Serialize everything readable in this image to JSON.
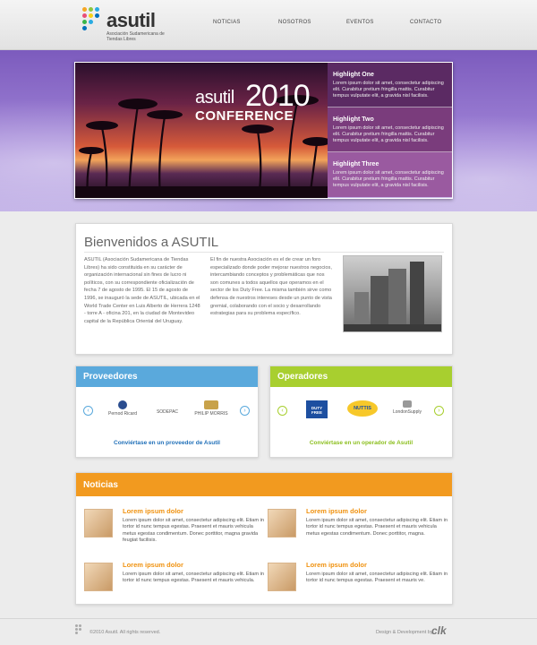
{
  "brand": {
    "name": "asutil",
    "subtitle": "Asociación Sudamericana de Tiendas Libres"
  },
  "nav": [
    "NOTICIAS",
    "NOSOTROS",
    "EVENTOS",
    "CONTACTO"
  ],
  "hero": {
    "brand": "asutil",
    "year": "2010",
    "word": "CONFERENCE",
    "highlights": [
      {
        "title": "Highlight One",
        "text": "Lorem ipsum dolor sit amet, consectetur adipiscing elit. Curabitur pretium fringilla mattis. Curabitur tempus vulputate elit, a gravida nisl facilisis."
      },
      {
        "title": "Highlight Two",
        "text": "Lorem ipsum dolor sit amet, consectetur adipiscing elit. Curabitur pretium fringilla mattis. Curabitur tempus vulputate elit, a gravida nisl facilisis."
      },
      {
        "title": "Highlight Three",
        "text": "Lorem ipsum dolor sit amet, consectetur adipiscing elit. Curabitur pretium fringilla mattis. Curabitur tempus vulputate elit, a gravida nisl facilisis."
      }
    ]
  },
  "welcome": {
    "title": "Bienvenidos a ASUTIL",
    "col1": "ASUTIL (Asociación Sudamericana de Tiendas Libres) ha sido constituida en su carácter de organización internacional sin fines de lucro ni políticos, con su correspondiente oficialización de fecha 7 de agosto de 1995. El 15 de agosto de 1996, se inauguró la sede de ASUTIL, ubicada en el World Trade Center en Luis Alberto de Herrera 1248 - torre A - oficina 201, en la ciudad de Montevideo capital de la República Oriental del Uruguay.",
    "col2": "El fin de nuestra Asociación es el de crear un foro especializado donde poder mejorar nuestros negocios, intercambiando conceptos y problemáticas que nos son comunes a todos aquellos que operamos en el sector de los Duty Free. La misma también sirve como defensa de nuestros intereses desde un punto de vista gremial, colaborando con el socio y desarrollando estrategias para su problema específico."
  },
  "proveedores": {
    "title": "Proveedores",
    "logos": [
      "Pernod Ricard",
      "SODEPAC",
      "PHILIP MORRIS"
    ],
    "link": "Conviértase en un proveedor de Asutil",
    "color": "#5aa9dc"
  },
  "operadores": {
    "title": "Operadores",
    "logos": [
      "DUTY FREE",
      "NUTTIS",
      "LondonSupply"
    ],
    "link": "Conviértase en un operador de Asutil",
    "color": "#a8cf2f"
  },
  "news": {
    "title": "Noticias",
    "items": [
      {
        "title": "Lorem ipsum dolor",
        "text": "Lorem ipsum dolor sit amet, consectetur adipiscing elit. Etiam in tortor id nunc tempus egestas. Praesent et mauris vehicula metus egestas condimentum. Donec porttitor, magna gravida feugiat facilisis."
      },
      {
        "title": "Lorem ipsum dolor",
        "text": "Lorem ipsum dolor sit amet, consectetur adipiscing elit. Etiam in tortor id nunc tempus egestas. Praesent et mauris vehicula metus egestas condimentum. Donec porttitor, magna."
      },
      {
        "title": "Lorem ipsum dolor",
        "text": "Lorem ipsum dolor sit amet, consectetur adipiscing elit. Etiam in tortor id nunc tempus egestas. Praesent et mauris vehicula."
      },
      {
        "title": "Lorem ipsum dolor",
        "text": "Lorem ipsum dolor sit amet, consectetur adipiscing elit. Etiam in tortor id nunc tempus egestas. Praesent et mauris ve."
      }
    ]
  },
  "footer": {
    "copyright": "©2010 Asutil. All rights reserved.",
    "credit": "Design & Development by",
    "studio": "clk"
  }
}
